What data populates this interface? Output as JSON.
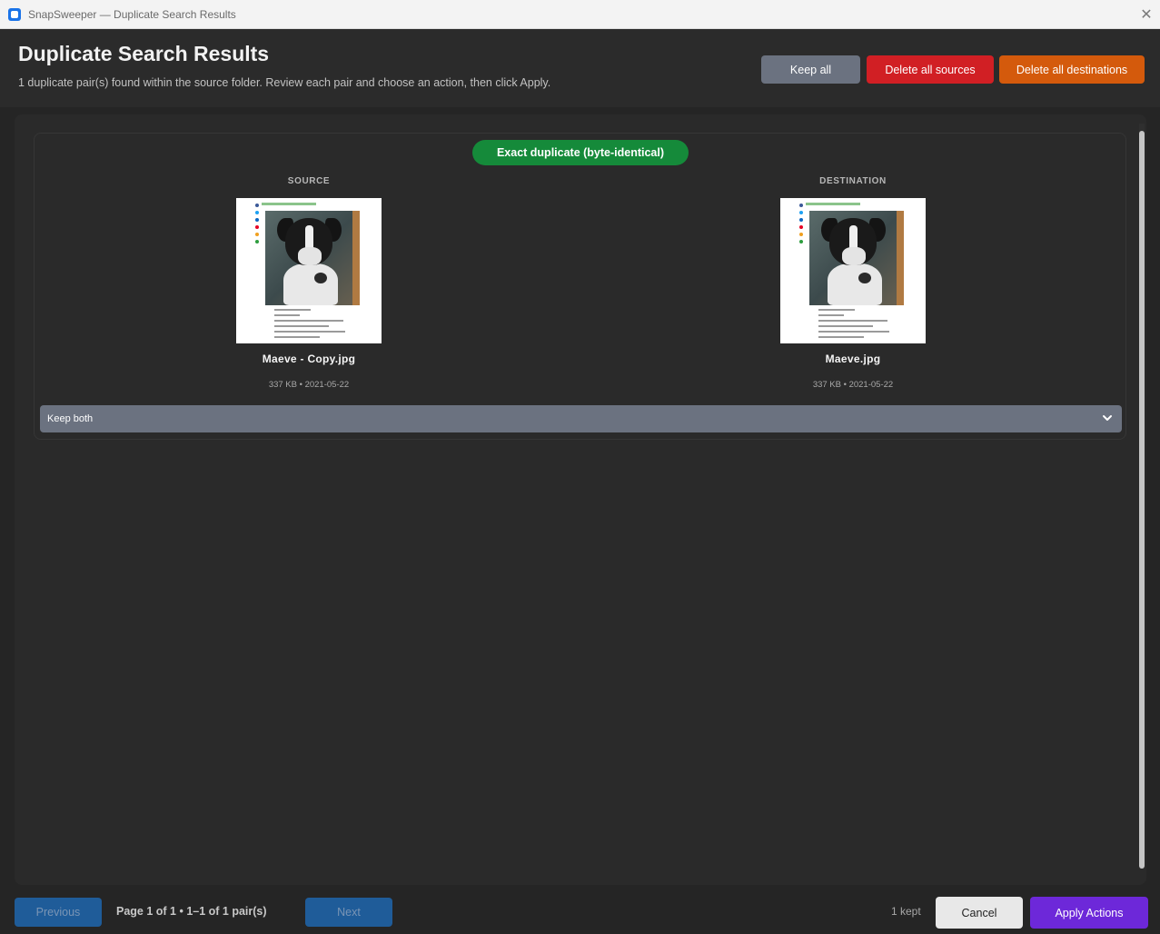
{
  "window": {
    "title": "SnapSweeper — Duplicate Search Results",
    "close_glyph": "✕"
  },
  "header": {
    "title": "Duplicate Search Results",
    "subtitle": "1 duplicate pair(s) found within the source folder. Review each pair and choose an action, then click Apply.",
    "buttons": {
      "keep_all": "Keep all",
      "delete_all_sources": "Delete all sources",
      "delete_all_destinations": "Delete all destinations"
    }
  },
  "pair": {
    "badge": "Exact duplicate (byte-identical)",
    "source": {
      "label": "SOURCE",
      "filename": "Maeve - Copy.jpg",
      "meta": "337 KB • 2021-05-22"
    },
    "destination": {
      "label": "DESTINATION",
      "filename": "Maeve.jpg",
      "meta": "337 KB • 2021-05-22"
    },
    "action": {
      "selected": "Keep both"
    }
  },
  "footer": {
    "previous": "Previous",
    "next": "Next",
    "page_info": "Page 1 of 1  •  1–1 of 1 pair(s)",
    "kept": "1 kept",
    "cancel": "Cancel",
    "apply": "Apply Actions"
  },
  "colors": {
    "badge": "#158a3a",
    "keep_all": "#6b7280",
    "delete_sources": "#d11f24",
    "delete_destinations": "#d45a0c",
    "apply": "#6d28d9",
    "nav": "#1f5c99"
  },
  "icons": {
    "app": "app-icon",
    "close": "close-icon",
    "chevron": "chevron-down-icon"
  }
}
